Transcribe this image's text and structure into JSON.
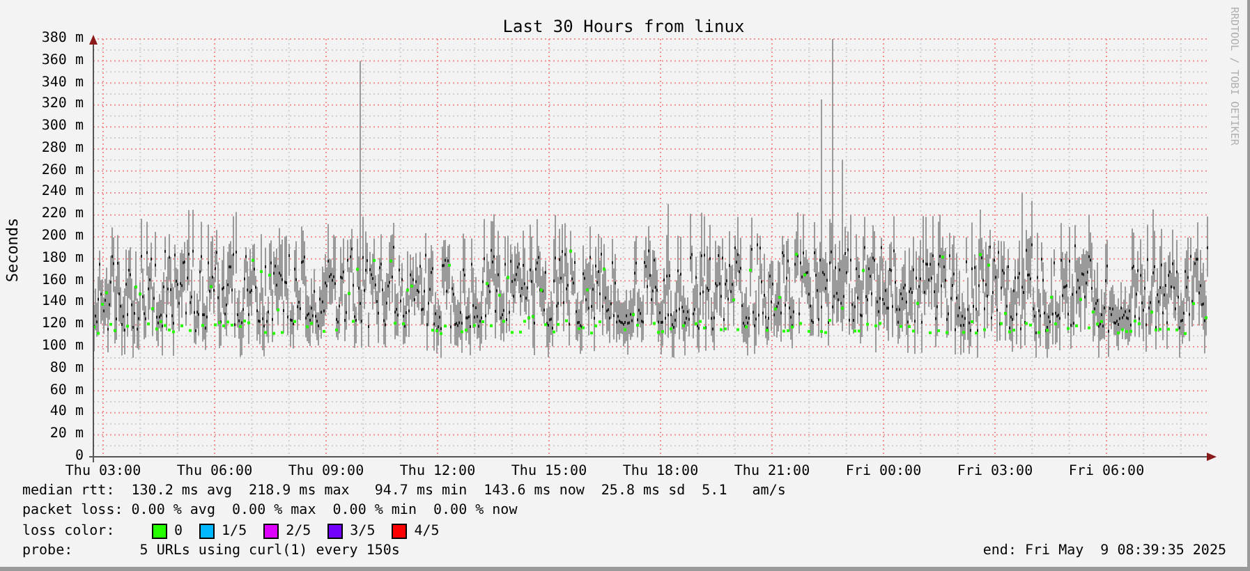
{
  "title": "Last 30 Hours from linux",
  "y_axis": {
    "label": "Seconds",
    "ticks": [
      "380 m",
      "360 m",
      "340 m",
      "320 m",
      "300 m",
      "280 m",
      "260 m",
      "240 m",
      "220 m",
      "200 m",
      "180 m",
      "160 m",
      "140 m",
      "120 m",
      "100 m",
      "80 m",
      "60 m",
      "40 m",
      "20 m",
      "0"
    ]
  },
  "x_axis": {
    "ticks": [
      "Thu 03:00",
      "Thu 06:00",
      "Thu 09:00",
      "Thu 12:00",
      "Thu 15:00",
      "Thu 18:00",
      "Thu 21:00",
      "Fri 00:00",
      "Fri 03:00",
      "Fri 06:00"
    ]
  },
  "credit": "RRDTOOL / TOBI OETIKER",
  "legend": {
    "median_rtt": "median rtt:  130.2 ms avg  218.9 ms max   94.7 ms min  143.6 ms now  25.8 ms sd  5.1   am/s",
    "packet_loss": "packet loss: 0.00 % avg  0.00 % max  0.00 % min  0.00 % now",
    "loss_color": {
      "label": "loss color:",
      "items": [
        {
          "label": "0",
          "color": "#26ff00"
        },
        {
          "label": "1/5",
          "color": "#00b8ff"
        },
        {
          "label": "2/5",
          "color": "#dd00ff"
        },
        {
          "label": "3/5",
          "color": "#7300ff"
        },
        {
          "label": "4/5",
          "color": "#ff0000"
        }
      ]
    },
    "probe": "probe:        5 URLs using curl(1) every 150s",
    "end": "end: Fri May  9 08:39:35 2025"
  }
}
